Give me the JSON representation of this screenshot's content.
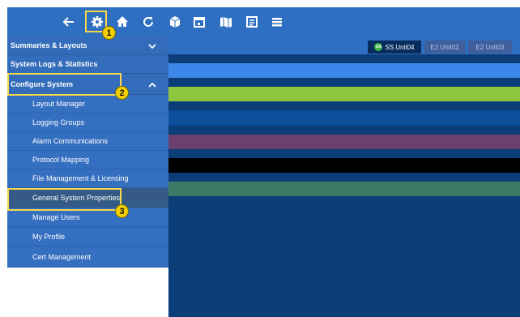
{
  "toolbar": {
    "icons": [
      "back-arrow-icon",
      "gear-icon",
      "home-icon",
      "refresh-icon",
      "box-icon",
      "calendar-icon",
      "map-icon",
      "schedule-icon",
      "list-icon"
    ]
  },
  "callouts": {
    "one": "1",
    "two": "2",
    "three": "3"
  },
  "sidebar": {
    "sections": [
      {
        "label": "Summaries & Layouts",
        "expanded": false
      },
      {
        "label": "System Logs & Statistics"
      },
      {
        "label": "Configure System",
        "expanded": true
      }
    ],
    "items": [
      {
        "label": "Layout Manager"
      },
      {
        "label": "Logging Groups"
      },
      {
        "label": "Alarm Communications"
      },
      {
        "label": "Protocol Mapping"
      },
      {
        "label": "File Management & Licensing"
      },
      {
        "label": "General System Properties",
        "active": true
      },
      {
        "label": "Manage Users"
      },
      {
        "label": "My Profile"
      },
      {
        "label": "Cert Management"
      }
    ]
  },
  "tabs": [
    {
      "badge": "SA",
      "label": "SS Unit04",
      "active": true
    },
    {
      "label": "E2 Unit02",
      "active": false
    },
    {
      "label": "E2 Unit03",
      "active": false
    }
  ],
  "colors": {
    "accent": "#2e6fc2",
    "stripe_light_blue": "#3d86ea",
    "stripe_green": "#8dc63f",
    "stripe_blue": "#0d4f9a",
    "stripe_purple": "#6b3f6e",
    "stripe_black": "#000000",
    "stripe_teal": "#3e7866"
  }
}
